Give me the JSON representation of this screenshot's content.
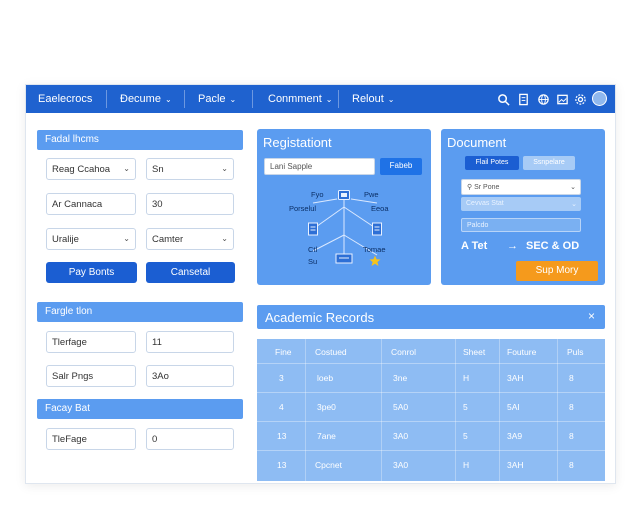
{
  "nav": {
    "items": [
      {
        "label": "Eaelecrocs",
        "chev": false
      },
      {
        "label": "Ðecume",
        "chev": true
      },
      {
        "label": "Pacle",
        "chev": true
      },
      {
        "label": "Conmment",
        "chev": true
      },
      {
        "label": "Relout",
        "chev": true
      }
    ],
    "icons": [
      "search-icon",
      "document-icon",
      "globe-icon",
      "image-icon",
      "gear-icon"
    ]
  },
  "left": {
    "section1": {
      "title": "Fadal lhcms"
    },
    "fields1": [
      {
        "value": "Reag Ccahoa",
        "dropdown": true
      },
      {
        "value": "Sn",
        "dropdown": true
      },
      {
        "value": "Ar Cannaca",
        "dropdown": false
      },
      {
        "value": "30",
        "dropdown": false
      },
      {
        "value": "Uralije",
        "dropdown": true
      },
      {
        "value": "Camter",
        "dropdown": true
      }
    ],
    "buttons": [
      "Pay Bonts",
      "Cansetal"
    ],
    "section2": {
      "title": "Fargle tlon"
    },
    "fields2": [
      {
        "value": "Tlerfage"
      },
      {
        "value": "11"
      },
      {
        "value": "Salr Pngs"
      },
      {
        "value": "3Ao"
      }
    ],
    "section3": {
      "title": "Facay Bat"
    },
    "fields3": [
      {
        "value": "TleFage"
      },
      {
        "value": "0"
      }
    ]
  },
  "registration": {
    "title": "Registationt",
    "search_placeholder": "Lani Sapple",
    "search_button": "Fabeb",
    "diagram_labels": [
      "Fyo",
      "Pwe",
      "Porselul",
      "Eeoa",
      "Ctl",
      "Tomae",
      "Su"
    ]
  },
  "document": {
    "title": "Document",
    "tabs": [
      "Flail Potes",
      "Ssnpelare"
    ],
    "select_label": "Sr Pone",
    "row1": "Cevvas Stat",
    "row2": "Palcdo",
    "total_label": "A Tet",
    "arrow": "→",
    "total_value": "SEC & OD",
    "signup": "Sup Mory"
  },
  "records": {
    "title": "Academic Records",
    "close": "×",
    "headers": [
      "Fine",
      "Costued",
      "Conrol",
      "Sheet",
      "Fouture",
      "Puls"
    ],
    "rows": [
      [
        "3",
        "loeb",
        "3ne",
        "H",
        "3AH",
        "8"
      ],
      [
        "4",
        "3pe0",
        "5A0",
        "5",
        "5AI",
        "8"
      ],
      [
        "13",
        "7ane",
        "3A0",
        "5",
        "3A9",
        "8"
      ],
      [
        "13",
        "Cpcnet",
        "3A0",
        "H",
        "3AH",
        "8"
      ]
    ]
  },
  "colors": {
    "primary": "#1f62cf",
    "accent": "#5b9cf0",
    "cta": "#f59a1c",
    "table": "#8ebcf3"
  }
}
